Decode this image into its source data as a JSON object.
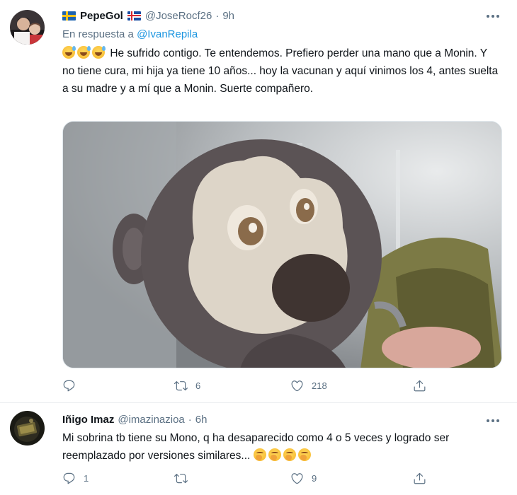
{
  "tweets": [
    {
      "author_name": "PepeGol",
      "handle": "@JoseRocf26",
      "separator": "·",
      "time": "9h",
      "reply_prefix": "En respuesta a",
      "reply_handle": "@IvanRepila",
      "text": "He sufrido contigo. Te entendemos. Prefiero perder una mano que a Monin. Y no tiene cura, mi hija ya tiene 10 años... hoy la vacunan y aquí vinimos los 4, antes suelta a su madre y a mí que a Monin. Suerte compañero.",
      "emojis": [
        "sweat-smile",
        "sweat-smile",
        "sweat-smile"
      ],
      "flags": [
        "sweden-flag",
        "iceland-flag"
      ],
      "replies": "",
      "retweets": "6",
      "likes": "218"
    },
    {
      "author_name": "Iñigo Imaz",
      "handle": "@imazinazioa",
      "separator": "·",
      "time": "6h",
      "text": "Mi sobrina tb tiene su Mono, q ha desaparecido como 4 o 5 veces y logrado ser reemplazado por versiones similares...",
      "emojis": [
        "yawning-face",
        "yawning-face",
        "yawning-face",
        "yawning-face"
      ],
      "replies": "1",
      "retweets": "",
      "likes": "9"
    }
  ],
  "colors": {
    "text": "#0f1419",
    "secondary": "#5b7083",
    "link": "#1b95e0",
    "border": "#ebeef0"
  },
  "icons": {
    "reply": "reply-icon",
    "retweet": "retweet-icon",
    "like": "heart-icon",
    "share": "share-icon",
    "more": "more-icon"
  }
}
